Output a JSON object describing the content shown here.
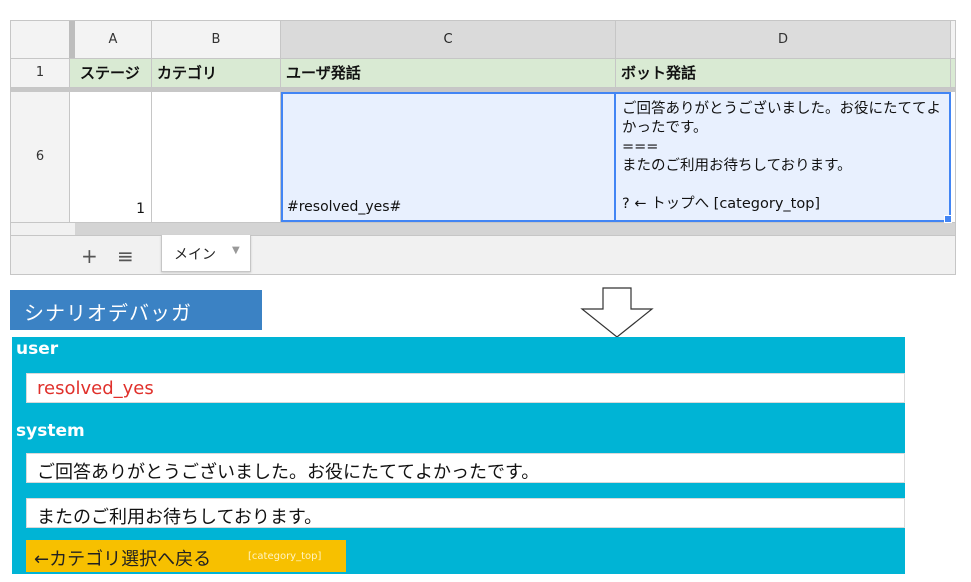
{
  "spreadsheet": {
    "columns": [
      "A",
      "B",
      "C",
      "D"
    ],
    "header_row": {
      "row_number": "1",
      "cells": [
        "ステージ",
        "カテゴリ",
        "ユーザ発話",
        "ボット発話"
      ]
    },
    "data_row": {
      "row_number": "6",
      "stage": "1",
      "category": "",
      "user_utterance": "#resolved_yes#",
      "bot_utterance": "ご回答ありがとうございました。お役にたててよかったです。\n===\nまたのご利用お待ちしております。\n\n? ← トップへ [category_top]"
    },
    "tab_bar": {
      "add_icon": "+",
      "list_icon": "≡",
      "sheet_tab_label": "メイン",
      "caret": "▼"
    }
  },
  "debugger": {
    "title": "シナリオデバッガ",
    "user_label": "user",
    "user_message": "resolved_yes",
    "system_label": "system",
    "system_messages": [
      "ご回答ありがとうございました。お役にたててよかったです。",
      "またのご利用お待ちしております。"
    ],
    "choice_button": {
      "label": "←カテゴリ選択へ戻る",
      "tag": "[category_top]"
    }
  },
  "colors": {
    "header_green": "#d9ead3",
    "selection_blue": "#e8f0fe",
    "active_border": "#4285f4",
    "title_blue": "#3b82c4",
    "panel_cyan": "#00b4d5",
    "user_text_red": "#e0302b",
    "choice_yellow": "#f7c000"
  },
  "icons": [
    "arrow-down-outline-icon",
    "plus-icon",
    "list-icon",
    "caret-down-icon"
  ]
}
